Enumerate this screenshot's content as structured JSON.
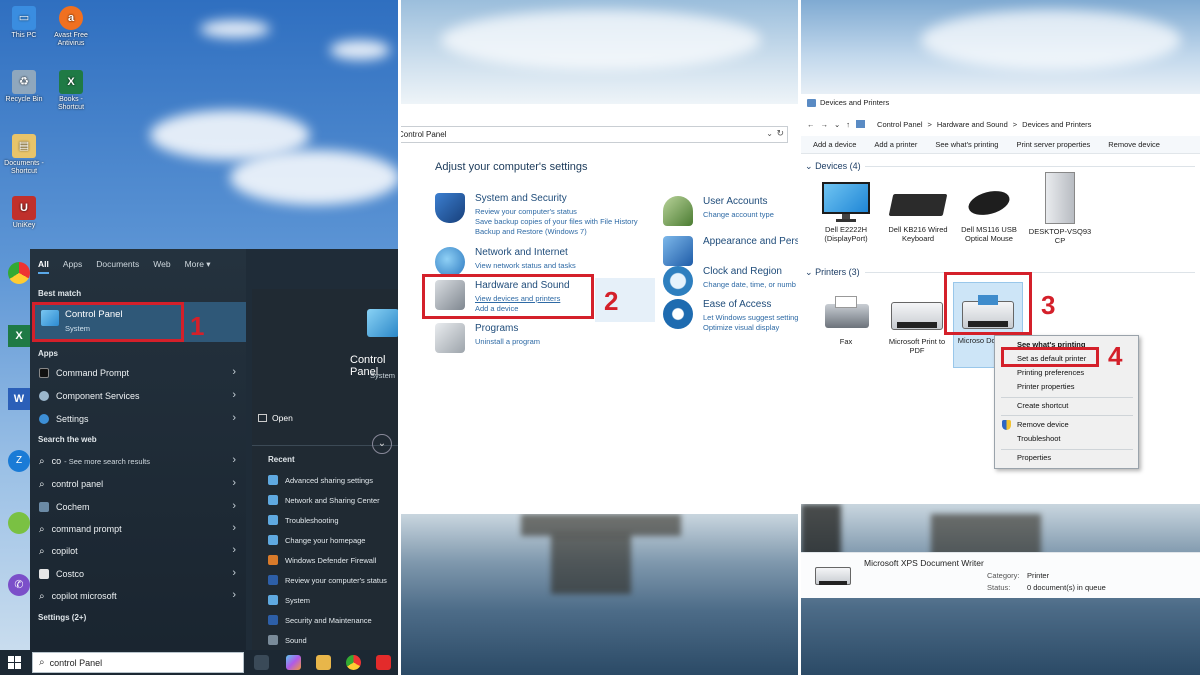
{
  "panel1": {
    "desktop_icons": [
      {
        "label": "This PC",
        "icon": "this-pc-icon",
        "color": "#3a8de0"
      },
      {
        "label": "Avast Free Antivirus",
        "icon": "avast-icon",
        "color": "#f07020"
      },
      {
        "label": "Recycle Bin",
        "icon": "recycle-bin-icon",
        "color": "#8fa7bd"
      },
      {
        "label": "Books - Shortcut",
        "icon": "excel-icon",
        "color": "#1f7a45"
      },
      {
        "label": "Documents - Shortcut",
        "icon": "folder-icon",
        "color": "#e8c46a"
      },
      {
        "label": "UniKey",
        "icon": "unikey-icon",
        "color": "#c0302c"
      }
    ],
    "start_menu": {
      "tabs": [
        "All",
        "Apps",
        "Documents",
        "Web",
        "More ▾"
      ],
      "best_match_header": "Best match",
      "best_match": {
        "title": "Control Panel",
        "subtitle": "System"
      },
      "apps_header": "Apps",
      "apps": [
        "Command Prompt",
        "Component Services",
        "Settings"
      ],
      "search_web_header": "Search the web",
      "web_results": [
        {
          "label": "co",
          "extra": "- See more search results"
        },
        {
          "label": "control panel",
          "extra": ""
        },
        {
          "label": "Cochem",
          "extra": ""
        },
        {
          "label": "command prompt",
          "extra": ""
        },
        {
          "label": "copilot",
          "extra": ""
        },
        {
          "label": "Costco",
          "extra": ""
        },
        {
          "label": "copilot microsoft",
          "extra": ""
        }
      ],
      "settings_header": "Settings (2+)",
      "right_title": "Control Panel",
      "right_subtitle": "System",
      "open_label": "Open",
      "recent_header": "Recent",
      "recent": [
        "Advanced sharing settings",
        "Network and Sharing Center",
        "Troubleshooting",
        "Change your homepage",
        "Windows Defender Firewall",
        "Review your computer's status",
        "System",
        "Security and Maintenance",
        "Sound"
      ]
    },
    "taskbar": {
      "search_value": "control Panel"
    },
    "step_label": "1"
  },
  "panel2": {
    "address": "Control Panel",
    "heading": "Adjust your computer's settings",
    "categories_left": [
      {
        "title": "System and Security",
        "links": [
          "Review your computer's status",
          "Save backup copies of your files with File History",
          "Backup and Restore (Windows 7)"
        ],
        "icon": "system-security-icon",
        "color": "#1f5fae"
      },
      {
        "title": "Network and Internet",
        "links": [
          "View network status and tasks"
        ],
        "icon": "network-icon",
        "color": "#3b88c9"
      },
      {
        "title": "Hardware and Sound",
        "links": [
          "View devices and printers",
          "Add a device"
        ],
        "icon": "hardware-sound-icon",
        "color": "#8a9099"
      },
      {
        "title": "Programs",
        "links": [
          "Uninstall a program"
        ],
        "icon": "programs-icon",
        "color": "#b7bcc2"
      }
    ],
    "categories_right": [
      {
        "title": "User Accounts",
        "links": [
          "Change account type"
        ],
        "icon": "user-accounts-icon",
        "color": "#5b8a3c"
      },
      {
        "title": "Appearance and Perso",
        "links": [],
        "icon": "appearance-icon",
        "color": "#2f6db5"
      },
      {
        "title": "Clock and Region",
        "links": [
          "Change date, time, or numb"
        ],
        "icon": "clock-region-icon",
        "color": "#2e7fbf"
      },
      {
        "title": "Ease of Access",
        "links": [
          "Let Windows suggest setting",
          "Optimize visual display"
        ],
        "icon": "ease-access-icon",
        "color": "#1e6bb0"
      }
    ],
    "step_label": "2"
  },
  "panel3": {
    "window_title": "Devices and Printers",
    "breadcrumb": [
      "Control Panel",
      ">",
      "Hardware and Sound",
      ">",
      "Devices and Printers"
    ],
    "toolbar": [
      "Add a device",
      "Add a printer",
      "See what's printing",
      "Print server properties",
      "Remove device"
    ],
    "devices_header": "Devices (4)",
    "devices": [
      {
        "label": "Dell E2222H (DisplayPort)",
        "icon": "monitor-icon"
      },
      {
        "label": "Dell KB216 Wired Keyboard",
        "icon": "keyboard-icon"
      },
      {
        "label": "Dell MS116 USB Optical Mouse",
        "icon": "mouse-icon"
      },
      {
        "label": "DESKTOP-VSQ93 CP",
        "icon": "computer-icon"
      }
    ],
    "printers_header": "Printers (3)",
    "printers": [
      {
        "label": "Fax",
        "icon": "fax-icon"
      },
      {
        "label": "Microsoft Print to PDF",
        "icon": "printer-icon"
      },
      {
        "label": "Microso Documen",
        "icon": "printer-icon"
      }
    ],
    "context_menu": [
      {
        "label": "See what's printing",
        "bold": true
      },
      {
        "label": "Set as default printer",
        "bold": false
      },
      {
        "label": "Printing preferences",
        "bold": false
      },
      {
        "label": "Printer properties",
        "bold": false
      },
      {
        "label": "Create shortcut",
        "bold": false
      },
      {
        "label": "Remove device",
        "bold": false
      },
      {
        "label": "Troubleshoot",
        "bold": false
      },
      {
        "label": "Properties",
        "bold": false
      }
    ],
    "details": {
      "name": "Microsoft XPS Document Writer",
      "category_label": "Category:",
      "category_value": "Printer",
      "status_label": "Status:",
      "status_value": "0 document(s) in queue"
    },
    "step3_label": "3",
    "step4_label": "4"
  },
  "colors": {
    "highlight_red": "#d4202a",
    "start_bg": "#1f2c38",
    "link_blue": "#2e6aa5"
  }
}
